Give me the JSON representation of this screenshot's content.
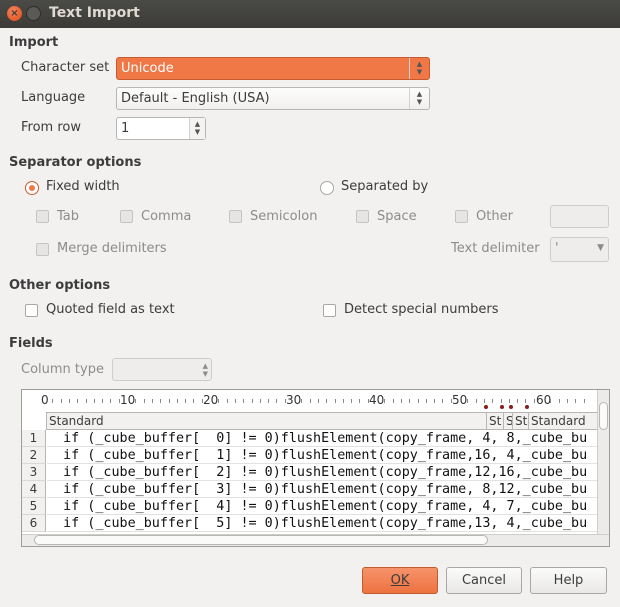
{
  "window": {
    "title": "Text Import"
  },
  "import": {
    "heading": "Import",
    "charset_label": "Character set",
    "charset_value": "Unicode",
    "language_label": "Language",
    "language_value": "Default - English (USA)",
    "from_row_label": "From row",
    "from_row_value": "1"
  },
  "separator": {
    "heading": "Separator options",
    "fixed_width": "Fixed width",
    "separated_by": "Separated by",
    "selected": "Fixed width",
    "tab": "Tab",
    "comma": "Comma",
    "semicolon": "Semicolon",
    "space": "Space",
    "other": "Other",
    "merge": "Merge delimiters",
    "text_delimiter_label": "Text delimiter",
    "text_delimiter_value": "'"
  },
  "other": {
    "heading": "Other options",
    "quoted": "Quoted field as text",
    "detect": "Detect special numbers"
  },
  "fields": {
    "heading": "Fields",
    "column_type_label": "Column type",
    "ruler": [
      "0",
      "10",
      "20",
      "30",
      "40",
      "50",
      "60"
    ],
    "headers": [
      "Standard",
      "St",
      "S",
      "St",
      "Standard"
    ],
    "row_numbers": [
      "1",
      "2",
      "3",
      "4",
      "5",
      "6"
    ],
    "rows": [
      "  if (_cube_buffer[  0] != 0)flushElement(copy_frame, 4, 8,_cube_bu",
      "  if (_cube_buffer[  1] != 0)flushElement(copy_frame,16, 4,_cube_bu",
      "  if (_cube_buffer[  2] != 0)flushElement(copy_frame,12,16,_cube_bu",
      "  if (_cube_buffer[  3] != 0)flushElement(copy_frame, 8,12,_cube_bu",
      "  if (_cube_buffer[  4] != 0)flushElement(copy_frame, 4, 7,_cube_bu",
      "  if (_cube_buffer[  5] != 0)flushElement(copy_frame,13, 4,_cube_bu"
    ]
  },
  "buttons": {
    "ok": "OK",
    "cancel": "Cancel",
    "help": "Help"
  },
  "colors": {
    "accent": "#f07746",
    "titlebar": "#3c3b37",
    "background": "#f2f1f0"
  }
}
